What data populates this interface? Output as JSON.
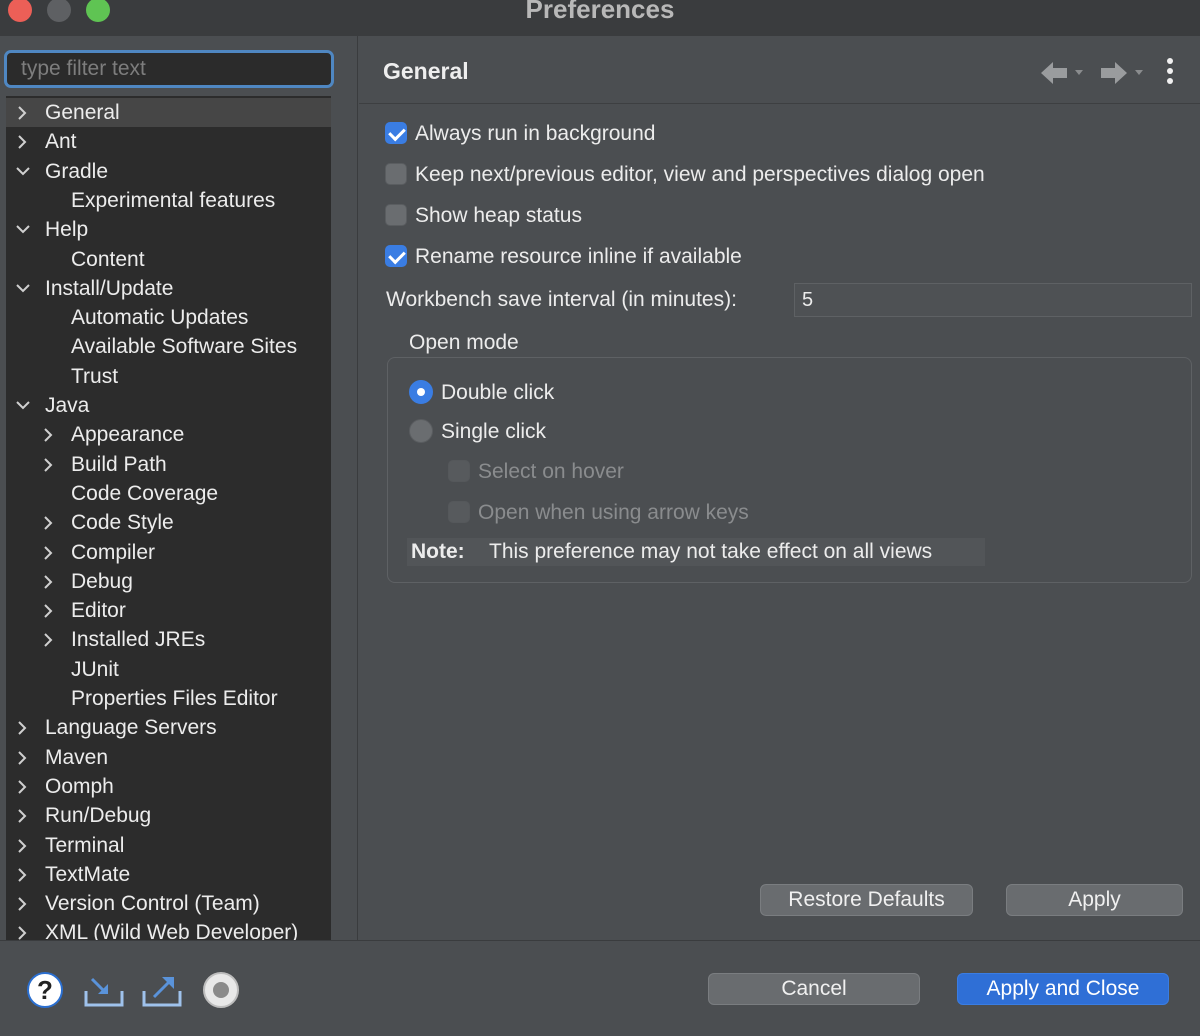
{
  "window": {
    "title": "Preferences"
  },
  "filter": {
    "placeholder": "type filter text",
    "value": ""
  },
  "tree": [
    {
      "label": "General",
      "depth": 0,
      "chevron": "right",
      "selected": true
    },
    {
      "label": "Ant",
      "depth": 0,
      "chevron": "right"
    },
    {
      "label": "Gradle",
      "depth": 0,
      "chevron": "down"
    },
    {
      "label": "Experimental features",
      "depth": 1,
      "chevron": "none"
    },
    {
      "label": "Help",
      "depth": 0,
      "chevron": "down"
    },
    {
      "label": "Content",
      "depth": 1,
      "chevron": "none"
    },
    {
      "label": "Install/Update",
      "depth": 0,
      "chevron": "down"
    },
    {
      "label": "Automatic Updates",
      "depth": 1,
      "chevron": "none"
    },
    {
      "label": "Available Software Sites",
      "depth": 1,
      "chevron": "none"
    },
    {
      "label": "Trust",
      "depth": 1,
      "chevron": "none"
    },
    {
      "label": "Java",
      "depth": 0,
      "chevron": "down"
    },
    {
      "label": "Appearance",
      "depth": 1,
      "chevron": "right"
    },
    {
      "label": "Build Path",
      "depth": 1,
      "chevron": "right"
    },
    {
      "label": "Code Coverage",
      "depth": 1,
      "chevron": "none"
    },
    {
      "label": "Code Style",
      "depth": 1,
      "chevron": "right"
    },
    {
      "label": "Compiler",
      "depth": 1,
      "chevron": "right"
    },
    {
      "label": "Debug",
      "depth": 1,
      "chevron": "right"
    },
    {
      "label": "Editor",
      "depth": 1,
      "chevron": "right"
    },
    {
      "label": "Installed JREs",
      "depth": 1,
      "chevron": "right"
    },
    {
      "label": "JUnit",
      "depth": 1,
      "chevron": "none"
    },
    {
      "label": "Properties Files Editor",
      "depth": 1,
      "chevron": "none"
    },
    {
      "label": "Language Servers",
      "depth": 0,
      "chevron": "right"
    },
    {
      "label": "Maven",
      "depth": 0,
      "chevron": "right"
    },
    {
      "label": "Oomph",
      "depth": 0,
      "chevron": "right"
    },
    {
      "label": "Run/Debug",
      "depth": 0,
      "chevron": "right"
    },
    {
      "label": "Terminal",
      "depth": 0,
      "chevron": "right"
    },
    {
      "label": "TextMate",
      "depth": 0,
      "chevron": "right"
    },
    {
      "label": "Version Control (Team)",
      "depth": 0,
      "chevron": "right"
    },
    {
      "label": "XML (Wild Web Developer)",
      "depth": 0,
      "chevron": "right"
    }
  ],
  "page": {
    "title": "General",
    "nav_icons": [
      "back-arrow-icon",
      "forward-arrow-icon",
      "kebab-menu-icon"
    ],
    "options": [
      {
        "label": "Always run in background",
        "checked": true
      },
      {
        "label": "Keep next/previous editor, view and perspectives dialog open",
        "checked": false
      },
      {
        "label": "Show heap status",
        "checked": false
      },
      {
        "label": "Rename resource inline if available",
        "checked": true
      }
    ],
    "save_interval_label": "Workbench save interval (in minutes):",
    "save_interval_value": "5",
    "open_mode": {
      "title": "Open mode",
      "double_click": "Double click",
      "single_click": "Single click",
      "selected": "Double click",
      "select_on_hover": "Select on hover",
      "open_arrow_keys": "Open when using arrow keys",
      "note_label": "Note:",
      "note_text": "This preference may not take effect on all views"
    },
    "restore_defaults_label": "Restore Defaults",
    "apply_label": "Apply"
  },
  "footer": {
    "icons": [
      "help-icon",
      "import-icon",
      "export-icon",
      "record-icon"
    ],
    "cancel_label": "Cancel",
    "apply_close_label": "Apply and Close"
  },
  "colors": {
    "accent": "#3a7de3",
    "panel": "#4b4e51",
    "tree_bg": "#2c2c2c"
  }
}
